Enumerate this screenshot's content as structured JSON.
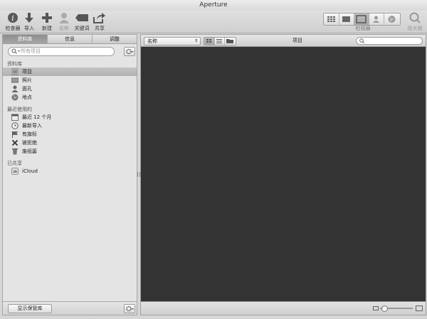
{
  "window": {
    "title": "Aperture"
  },
  "toolbar": {
    "left_buttons": [
      {
        "label": "检查器",
        "icon": "info-icon"
      },
      {
        "label": "导入",
        "icon": "import-arrow-icon"
      },
      {
        "label": "新建",
        "icon": "plus-icon"
      },
      {
        "label": "名称",
        "icon": "person-icon"
      },
      {
        "label": "关键词",
        "icon": "tag-icon"
      },
      {
        "label": "共享",
        "icon": "share-icon"
      }
    ],
    "viewer_label": "检视器",
    "zoom_label": "放大镜"
  },
  "sidebar": {
    "tabs": [
      "资料库",
      "信息",
      "调整"
    ],
    "search_placeholder": "所有项目",
    "sections": [
      {
        "title": "资料库",
        "items": [
          {
            "label": "项目",
            "icon": "projects-icon",
            "selected": true
          },
          {
            "label": "照片",
            "icon": "photos-icon"
          },
          {
            "label": "面孔",
            "icon": "faces-icon"
          },
          {
            "label": "地点",
            "icon": "globe-icon"
          }
        ]
      },
      {
        "title": "最近使用的",
        "items": [
          {
            "label": "最近 12 个月",
            "icon": "calendar-icon"
          },
          {
            "label": "最新导入",
            "icon": "clock-icon"
          },
          {
            "label": "有旗标",
            "icon": "flag-icon"
          },
          {
            "label": "被拒绝",
            "icon": "x-icon"
          },
          {
            "label": "废纸篓",
            "icon": "trash-icon"
          }
        ]
      },
      {
        "title": "已共享",
        "items": [
          {
            "label": "iCloud",
            "icon": "icloud-icon"
          }
        ]
      }
    ],
    "show_vault_button": "显示保管库"
  },
  "browser": {
    "sort_value": "名称",
    "title": "项目"
  },
  "colors": {
    "browser_bg": "#333333",
    "sidebar_bg": "#e4e4e4",
    "selection": "#b8b8b8"
  }
}
